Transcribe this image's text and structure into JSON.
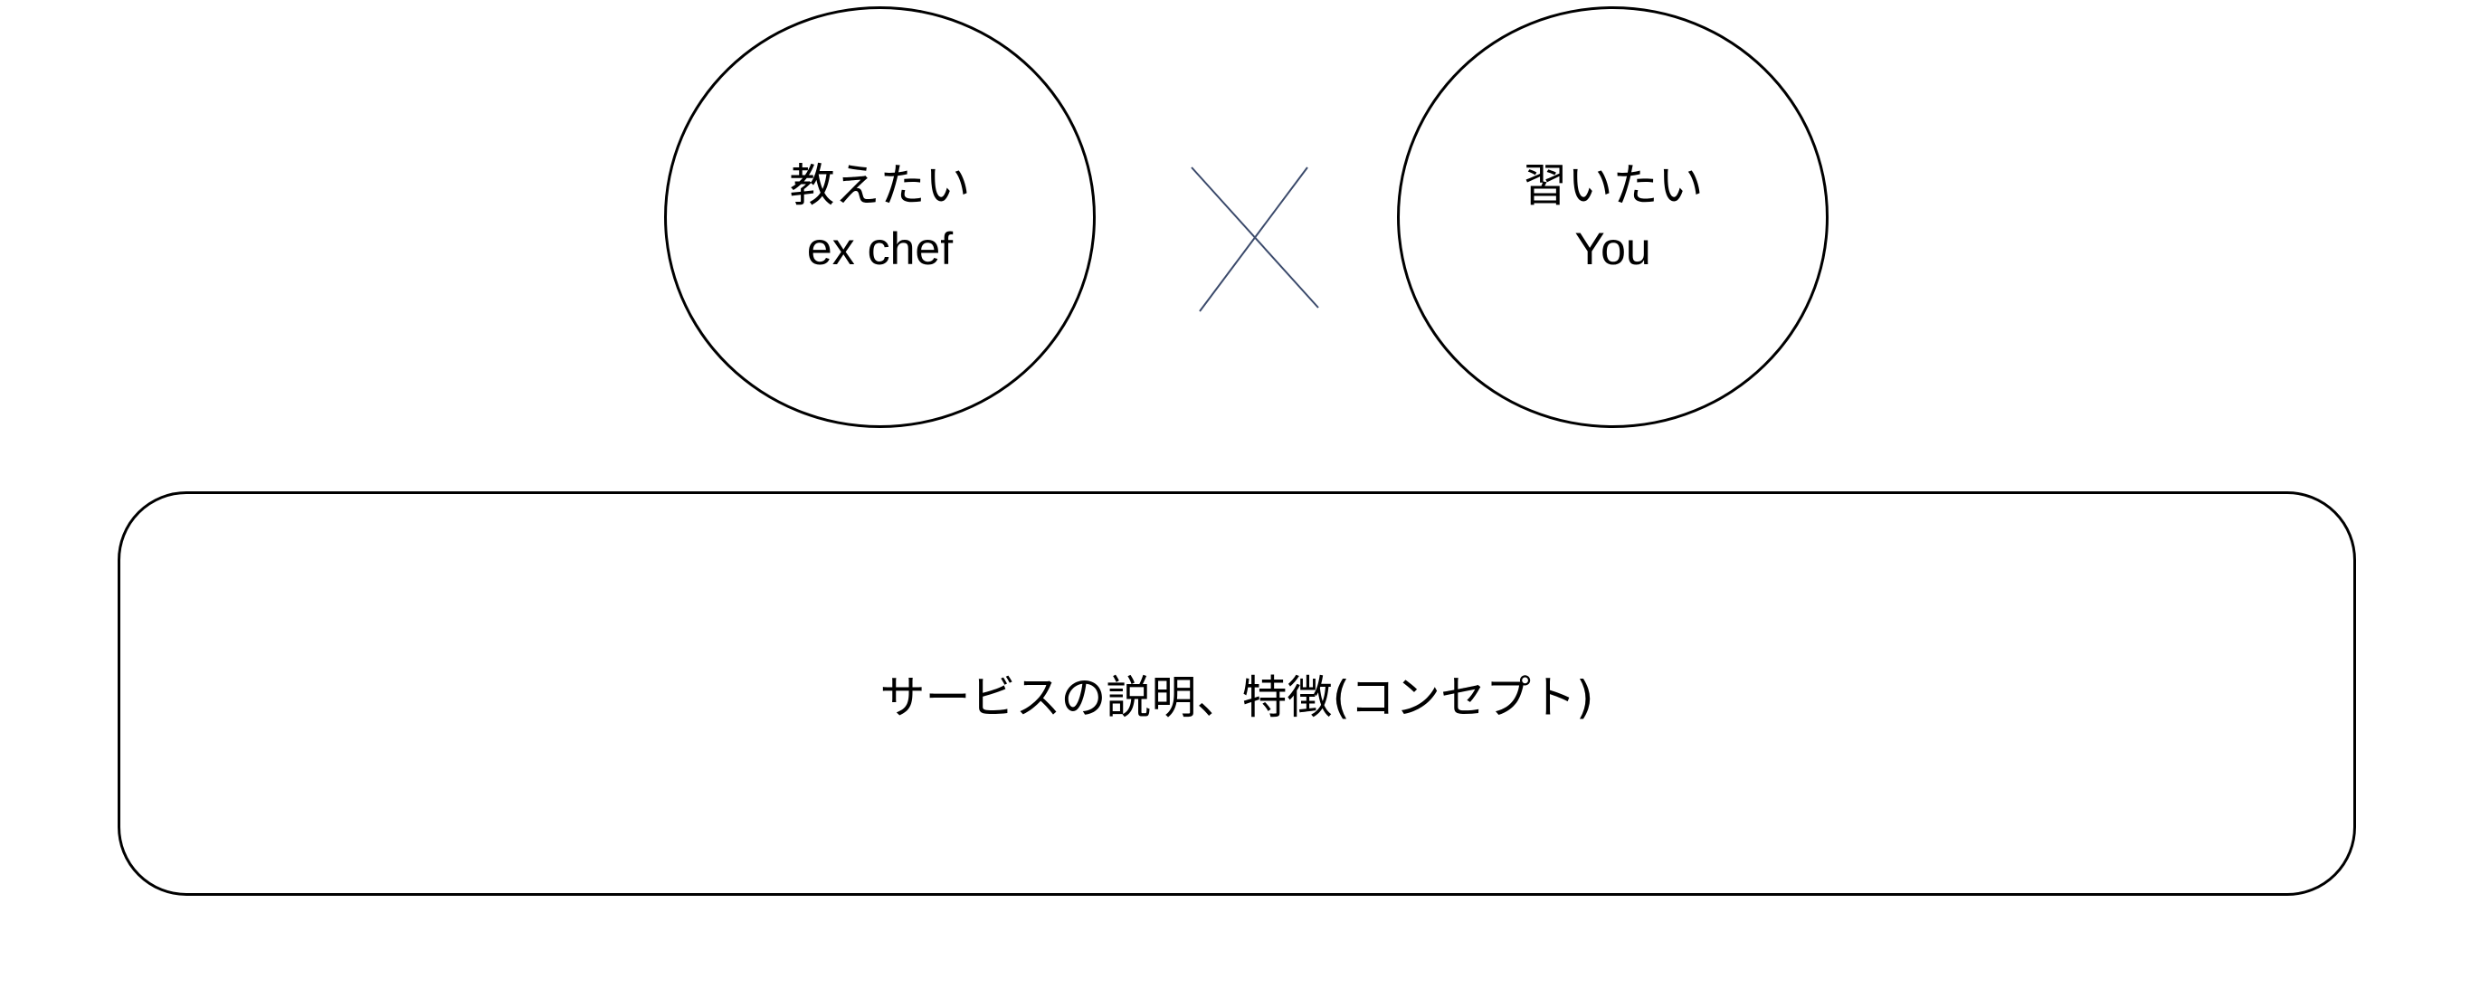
{
  "diagram": {
    "left_circle": {
      "line1": "教えたい",
      "line2": "ex chef"
    },
    "right_circle": {
      "line1": "習いたい",
      "line2": "You"
    },
    "cross_symbol": "cross-icon",
    "concept_box": {
      "text": "サービスの説明、特徴(コンセプト)"
    },
    "colors": {
      "outline": "#000000",
      "cross_stroke": "#3b4a6b",
      "background": "#ffffff"
    }
  }
}
